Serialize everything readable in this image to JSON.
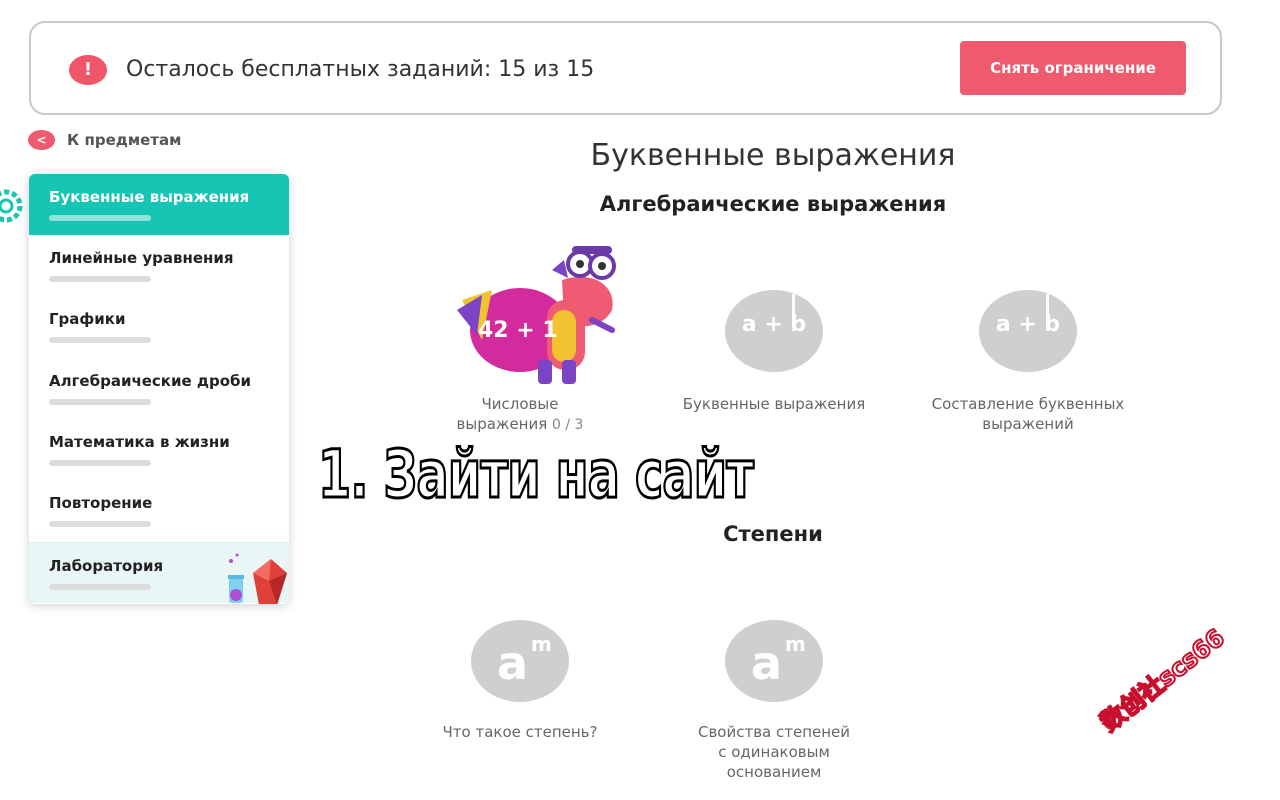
{
  "banner": {
    "alert_icon": "!",
    "message": "Осталось бесплатных заданий: 15 из 15",
    "button_label": "Снять ограничение"
  },
  "back_link": {
    "icon": "<",
    "label": "К предметам"
  },
  "sidebar": {
    "items": [
      {
        "label": "Буквенные выражения",
        "active": true
      },
      {
        "label": "Линейные уравнения"
      },
      {
        "label": "Графики"
      },
      {
        "label": "Алгебраические дроби"
      },
      {
        "label": "Математика в жизни"
      },
      {
        "label": "Повторение"
      },
      {
        "label": "Лаборатория"
      }
    ]
  },
  "main": {
    "title": "Буквенные выражения",
    "sections": [
      {
        "title": "Алгебраические выражения",
        "topics": [
          {
            "icon_text": "42 + 1",
            "caption_line1": "Числовые",
            "caption_line2": "выражения",
            "score": "0 / 3"
          },
          {
            "icon_text": "a + b",
            "caption_line1": "Буквенные выражения"
          },
          {
            "icon_text": "a + b",
            "caption_line1": "Составление буквенных",
            "caption_line2": "выражений"
          }
        ]
      },
      {
        "title": "Степени",
        "topics": [
          {
            "icon_base": "a",
            "icon_exp": "m",
            "caption_line1": "Что такое степень?"
          },
          {
            "icon_base": "a",
            "icon_exp": "m",
            "caption_line1": "Свойства степеней",
            "caption_line2": "с одинаковым",
            "caption_line3": "основанием"
          }
        ]
      }
    ]
  },
  "overlay_text": "1. Зайти на сайт",
  "watermark": "数创社scs66",
  "colors": {
    "accent_red": "#f05a6e",
    "teal": "#17c5b4",
    "magenta": "#d12b9e",
    "gray_icon": "#cfcfcf"
  }
}
